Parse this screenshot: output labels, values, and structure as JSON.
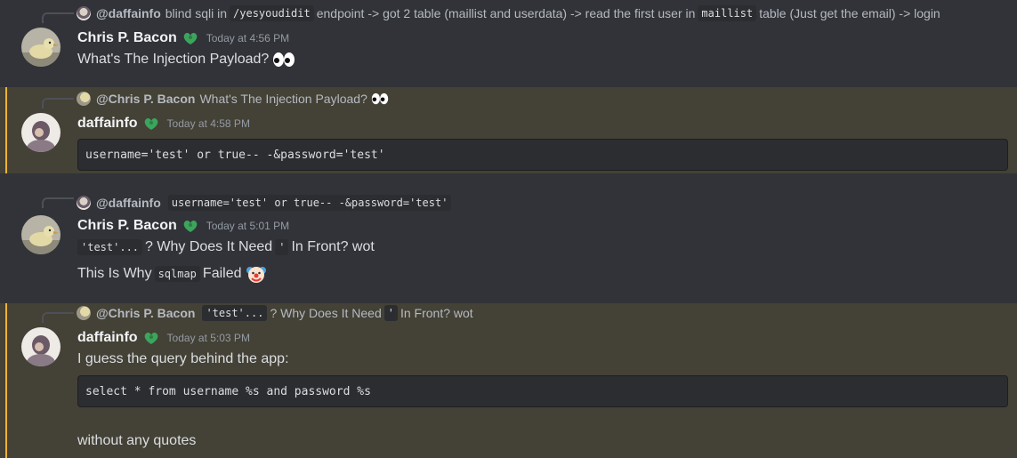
{
  "colors": {
    "background": "#313338",
    "mention_highlight": "#444136",
    "mention_bar": "#f0b232",
    "badge": "#3ba55c"
  },
  "messages": [
    {
      "reply": {
        "name": "@daffainfo",
        "pre": "blind sqli in",
        "code1": "/yesyoudidit",
        "mid": "endpoint -> got 2 table (maillist and userdata) -> read the first user in",
        "code2": "maillist",
        "post": "table (Just get the email) -> login"
      },
      "author": "Chris P. Bacon",
      "timestamp": "Today at 4:56 PM",
      "text": "What's The Injection Payload?",
      "emoji": "eyes-emoji"
    },
    {
      "reply": {
        "name": "@Chris P. Bacon",
        "text": "What's The Injection Payload?",
        "emoji": "eyes-emoji"
      },
      "author": "daffainfo",
      "timestamp": "Today at 4:58 PM",
      "code": "username='test' or true-- -&password='test'"
    },
    {
      "reply": {
        "name": "@daffainfo",
        "code": "username='test' or true-- -&password='test'"
      },
      "author": "Chris P. Bacon",
      "timestamp": "Today at 5:01 PM",
      "line1": {
        "code1": "'test'...",
        "text": "? Why Does It Need",
        "code2": "'",
        "post": "In Front? wot"
      },
      "line2": {
        "pre": "This Is Why",
        "code": "sqlmap",
        "post": "Failed",
        "emoji": "clown-emoji"
      }
    },
    {
      "reply": {
        "name": "@Chris P. Bacon",
        "code1": "'test'...",
        "text": "? Why Does It Need",
        "code2": "'",
        "post": "In Front? wot"
      },
      "author": "daffainfo",
      "timestamp": "Today at 5:03 PM",
      "text1": "I guess the query behind the app:",
      "code": "select * from username %s and password %s",
      "text2": "without any quotes"
    }
  ]
}
